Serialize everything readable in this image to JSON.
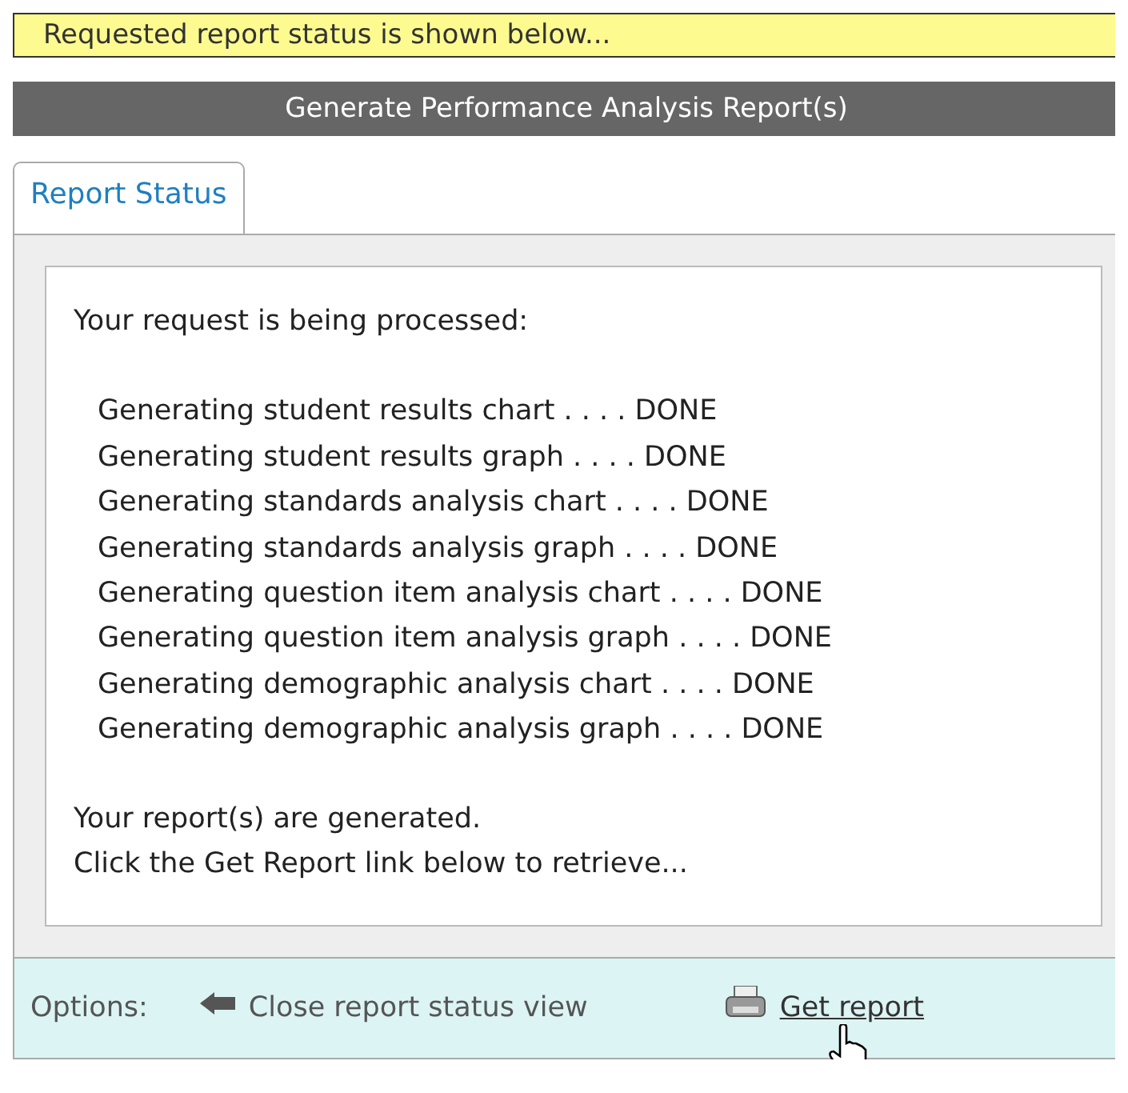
{
  "notice": "Requested report status is shown below...",
  "header": "Generate Performance Analysis Report(s)",
  "tabs": [
    {
      "label": "Report Status",
      "selected": true
    }
  ],
  "status": {
    "intro": "Your request is being processed:",
    "steps": [
      "Generating student results chart . . . . DONE",
      "Generating student results graph . . . . DONE",
      "Generating standards analysis chart . . . . DONE",
      "Generating standards analysis graph . . . . DONE",
      "Generating question item analysis chart . . . . DONE",
      "Generating question item analysis graph . . . . DONE",
      "Generating demographic analysis chart . . . . DONE",
      "Generating demographic analysis graph . . . . DONE"
    ],
    "result": [
      "Your report(s) are generated.",
      "Click the Get Report link below to retrieve..."
    ]
  },
  "options": {
    "label": "Options:",
    "close": "Close report status view",
    "get": "Get report"
  }
}
